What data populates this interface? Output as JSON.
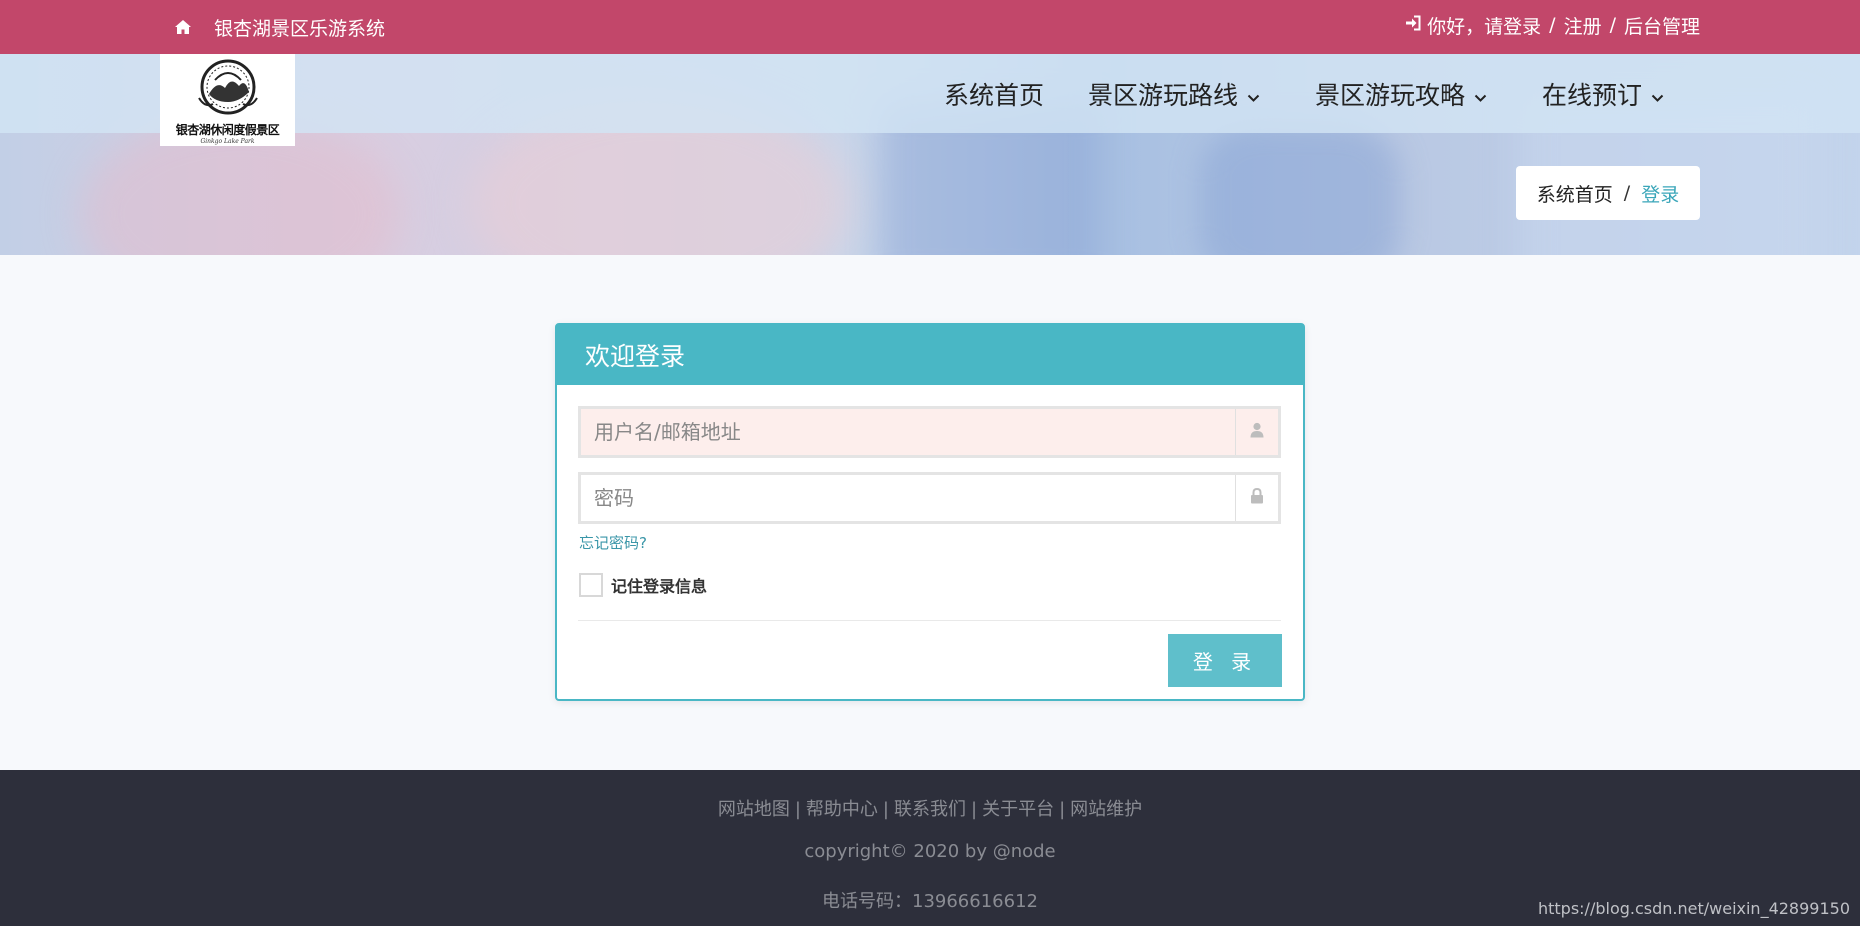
{
  "topbar": {
    "site_title": "银杏湖景区乐游系统",
    "greeting": "你好，请登录",
    "register": "注册",
    "separator": "/",
    "admin": "后台管理",
    "bg_color": "#c2476a"
  },
  "logo": {
    "text": "银杏湖休闲度假景区",
    "sub": "Ginkgo Lake Park"
  },
  "nav": {
    "items": [
      {
        "label": "系统首页",
        "has_dropdown": false
      },
      {
        "label": "景区游玩路线",
        "has_dropdown": true
      },
      {
        "label": "景区游玩攻略",
        "has_dropdown": true
      },
      {
        "label": "在线预订",
        "has_dropdown": true
      }
    ]
  },
  "breadcrumb": {
    "home": "系统首页",
    "separator": "/",
    "current": "登录"
  },
  "login": {
    "title": "欢迎登录",
    "username_placeholder": "用户名/邮箱地址",
    "password_placeholder": "密码",
    "forgot": "忘记密码?",
    "remember": "记住登录信息",
    "submit": "登 录",
    "accent_color": "#49b7c5"
  },
  "footer": {
    "links": [
      "网站地图",
      "帮助中心",
      "联系我们",
      "关于平台",
      "网站维护"
    ],
    "link_separator": "|",
    "copyright": "copyright© 2020 by @node",
    "phone": "电话号码：13966616612",
    "bg_color": "#2d2f3b"
  },
  "watermark": "https://blog.csdn.net/weixin_42899150"
}
